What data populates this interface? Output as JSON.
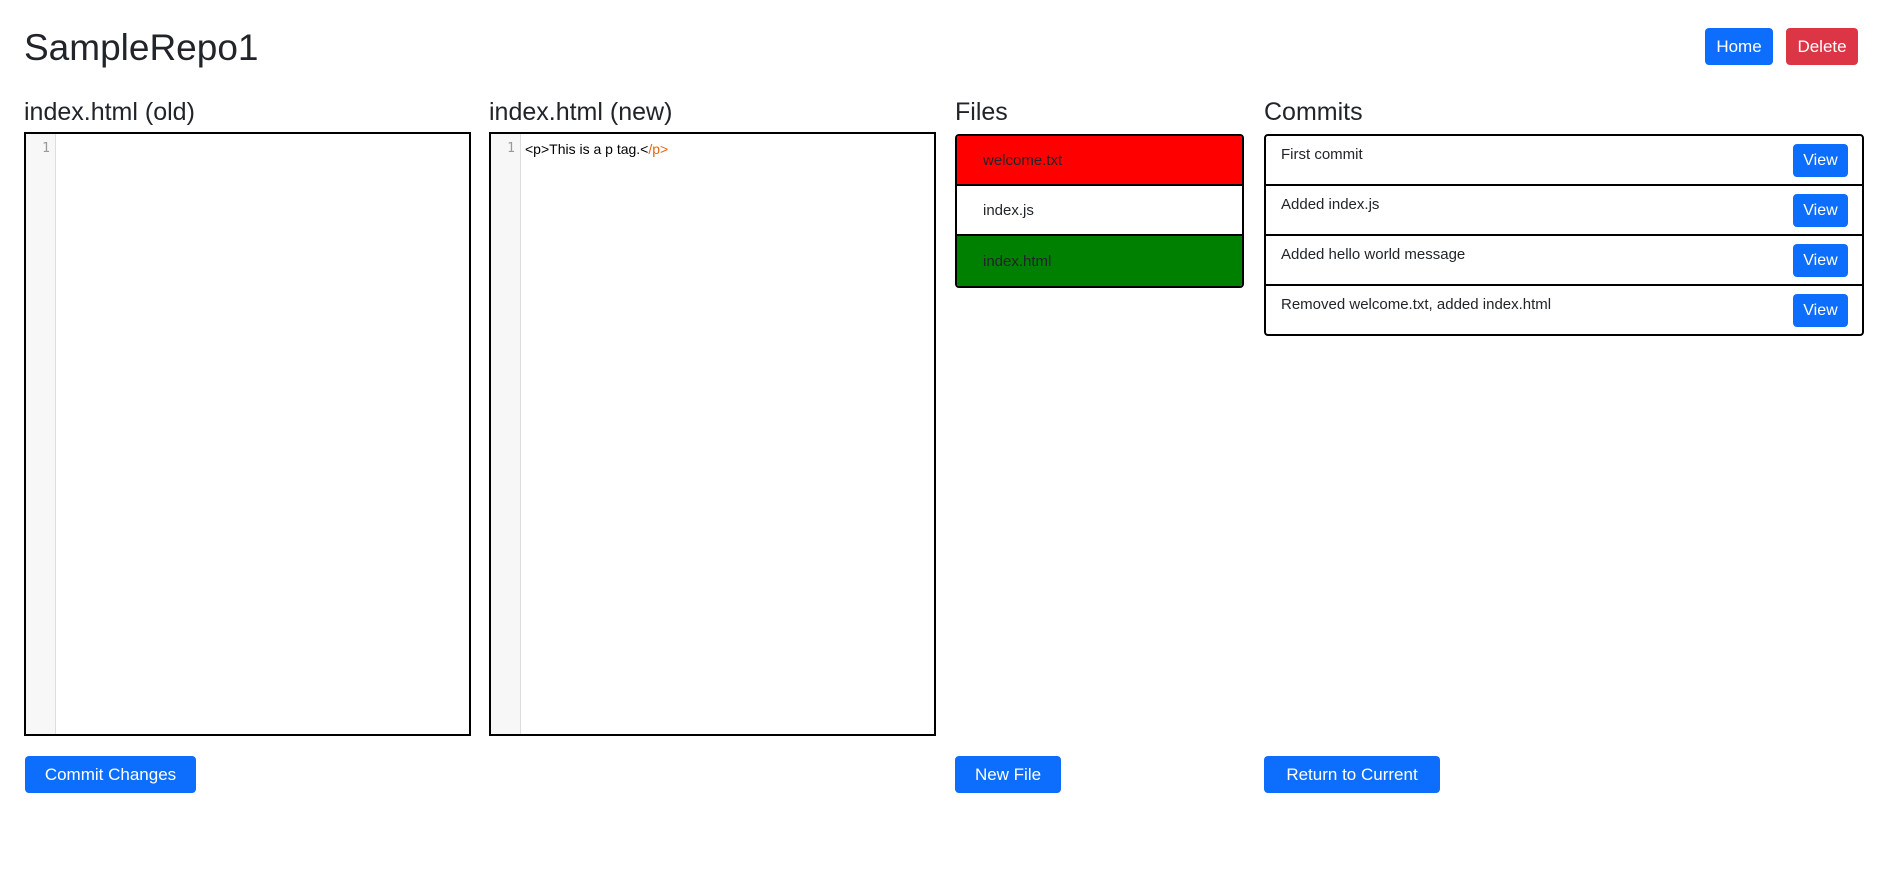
{
  "header": {
    "title": "SampleRepo1",
    "home_label": "Home",
    "delete_label": "Delete"
  },
  "old_panel": {
    "title": "index.html (old)",
    "lines": [
      ""
    ]
  },
  "new_panel": {
    "title": "index.html (new)",
    "line_number": "1",
    "code_open": "<p>This is a p tag.<",
    "code_close": "/p>"
  },
  "old_line_number": "1",
  "files": {
    "title": "Files",
    "items": [
      {
        "name": "welcome.txt",
        "status": "deleted",
        "color": "#ff0000"
      },
      {
        "name": "index.js",
        "status": "unchanged",
        "color": "#ffffff"
      },
      {
        "name": "index.html",
        "status": "added",
        "color": "#008000"
      }
    ],
    "new_file_label": "New File"
  },
  "commits": {
    "title": "Commits",
    "view_label": "View",
    "items": [
      {
        "message": "First commit"
      },
      {
        "message": "Added index.js"
      },
      {
        "message": "Added hello world message"
      },
      {
        "message": "Removed welcome.txt, added index.html"
      }
    ],
    "return_label": "Return to Current"
  },
  "actions": {
    "commit_changes_label": "Commit Changes"
  },
  "colors": {
    "primary": "#0d6efd",
    "danger": "#dc3545"
  }
}
